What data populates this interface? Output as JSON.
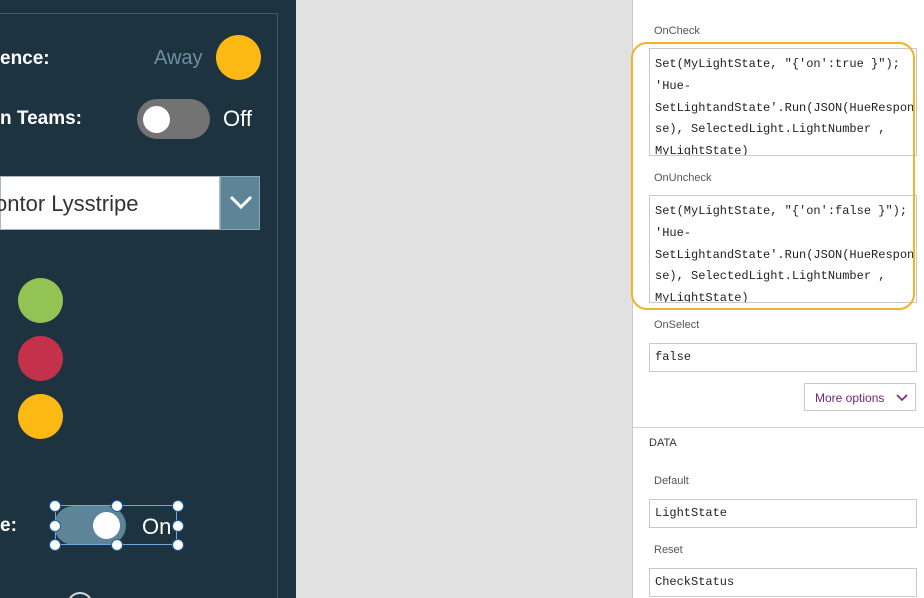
{
  "canvas": {
    "presence_label": "ence:",
    "presence_value": "Away",
    "teams_label": "n Teams:",
    "teams_toggle_text": "Off",
    "dropdown_value": "ontor Lysstripe",
    "state_label": "e:",
    "state_toggle_text": "On",
    "colors": {
      "presence_dot": "#fdb913",
      "green": "#92c353",
      "red": "#c4314b",
      "yellow": "#fdb913"
    }
  },
  "properties": {
    "oncheck_label": "OnCheck",
    "oncheck_code": "Set(MyLightState, \"{'on':true }\");\n'Hue-\nSetLightandState'.Run(JSON(HueRespon\nse), SelectedLight.LightNumber ,\nMyLightState)",
    "onuncheck_label": "OnUncheck",
    "onuncheck_code": "Set(MyLightState, \"{'on':false }\");\n'Hue-\nSetLightandState'.Run(JSON(HueRespon\nse), SelectedLight.LightNumber ,\nMyLightState)",
    "onselect_label": "OnSelect",
    "onselect_value": "false",
    "more_options": "More options",
    "data_section": "DATA",
    "default_label": "Default",
    "default_value": "LightState",
    "reset_label": "Reset",
    "reset_value": "CheckStatus"
  }
}
